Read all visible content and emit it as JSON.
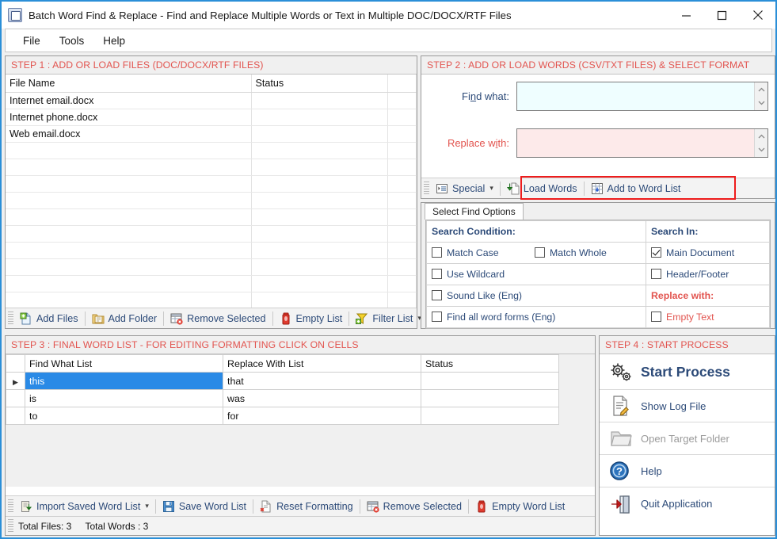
{
  "window": {
    "title": "Batch Word Find & Replace - Find and Replace Multiple Words or Text  in Multiple DOC/DOCX/RTF Files",
    "app_icon": "app-window-icon",
    "minimize_label": "Minimize",
    "maximize_label": "Maximize",
    "close_label": "Close",
    "accent_color": "#2b8fd8"
  },
  "menubar": {
    "items": [
      {
        "label": "File"
      },
      {
        "label": "Tools"
      },
      {
        "label": "Help"
      }
    ]
  },
  "step1": {
    "header": "STEP 1 : ADD OR LOAD FILES (DOC/DOCX/RTF FILES)",
    "columns": [
      "File Name",
      "Status",
      ""
    ],
    "rows": [
      {
        "file_name": "Internet email.docx",
        "status": ""
      },
      {
        "file_name": "Internet phone.docx",
        "status": ""
      },
      {
        "file_name": "Web email.docx",
        "status": ""
      }
    ],
    "toolbar": [
      {
        "label": "Add Files",
        "icon": "add-file-icon",
        "has_caret": false
      },
      {
        "label": "Add Folder",
        "icon": "add-folder-icon",
        "has_caret": false
      },
      {
        "label": "Remove Selected",
        "icon": "remove-selected-icon",
        "has_caret": false
      },
      {
        "label": "Empty List",
        "icon": "empty-list-icon",
        "has_caret": false
      },
      {
        "label": "Filter List",
        "icon": "filter-icon",
        "has_caret": true
      }
    ]
  },
  "step2": {
    "header": "STEP 2 : ADD OR LOAD WORDS (CSV/TXT FILES) & SELECT FORMAT",
    "find_label_pre": "Fi",
    "find_label_acc": "n",
    "find_label_post": "d what:",
    "find_value": "",
    "find_placeholder": "",
    "replace_label_pre": "Replace w",
    "replace_label_acc": "i",
    "replace_label_post": "th:",
    "replace_value": "",
    "replace_placeholder": "",
    "find_field_color": "#effeff",
    "replace_field_color": "#fdeaea",
    "toolbar": [
      {
        "label": "Special",
        "icon": "special-list-icon",
        "has_caret": true
      },
      {
        "label": "Load Words",
        "icon": "load-words-icon",
        "has_caret": false
      },
      {
        "label": "Add to Word List",
        "icon": "add-to-word-list-icon",
        "has_caret": false
      }
    ],
    "highlight_color": "#ee1c1c"
  },
  "find_options": {
    "tab_label": "Select Find Options",
    "search_condition_header": "Search Condition:",
    "search_in_header": "Search In:",
    "replace_with_header": "Replace with:",
    "conditions": [
      {
        "label": "Match Case",
        "checked": false
      },
      {
        "label": "Match Whole",
        "checked": false
      },
      {
        "label": "Use Wildcard",
        "checked": false
      },
      {
        "label": "Sound Like (Eng)",
        "checked": false
      },
      {
        "label": "Find all word forms (Eng)",
        "checked": false
      }
    ],
    "search_in": [
      {
        "label": "Main Document",
        "checked": true
      },
      {
        "label": "Header/Footer",
        "checked": false
      }
    ],
    "replace_with": [
      {
        "label": "Empty Text",
        "checked": false
      }
    ]
  },
  "step3": {
    "header": "STEP 3 : FINAL WORD LIST - FOR EDITING FORMATTING CLICK ON CELLS",
    "columns": [
      "Find What List",
      "Replace With List",
      "Status"
    ],
    "rows": [
      {
        "find": "this",
        "replace": "that",
        "status": "",
        "selected": true
      },
      {
        "find": "is",
        "replace": "was",
        "status": "",
        "selected": false
      },
      {
        "find": "to",
        "replace": "for",
        "status": "",
        "selected": false
      }
    ],
    "selection_color": "#2a8ae6",
    "toolbar": [
      {
        "label": "Import Saved Word List",
        "icon": "import-word-list-icon",
        "has_caret": true
      },
      {
        "label": "Save Word List",
        "icon": "save-icon",
        "has_caret": false
      },
      {
        "label": "Reset Formatting",
        "icon": "reset-formatting-icon",
        "has_caret": false
      },
      {
        "label": "Remove Selected",
        "icon": "remove-selected-icon",
        "has_caret": false
      },
      {
        "label": "Empty Word List",
        "icon": "empty-list-icon",
        "has_caret": false
      }
    ],
    "status_total_files": "Total Files: 3",
    "status_total_words": "Total Words : 3"
  },
  "step4": {
    "header": "STEP 4 : START PROCESS",
    "items": [
      {
        "label": "Start Process",
        "icon": "gears-icon",
        "primary": true,
        "disabled": false
      },
      {
        "label": "Show Log File",
        "icon": "log-file-icon",
        "primary": false,
        "disabled": false
      },
      {
        "label": "Open Target Folder",
        "icon": "open-folder-icon",
        "primary": false,
        "disabled": true
      },
      {
        "label": "Help",
        "icon": "help-icon",
        "primary": false,
        "disabled": false
      },
      {
        "label": "Quit Application",
        "icon": "quit-icon",
        "primary": false,
        "disabled": false
      }
    ]
  }
}
